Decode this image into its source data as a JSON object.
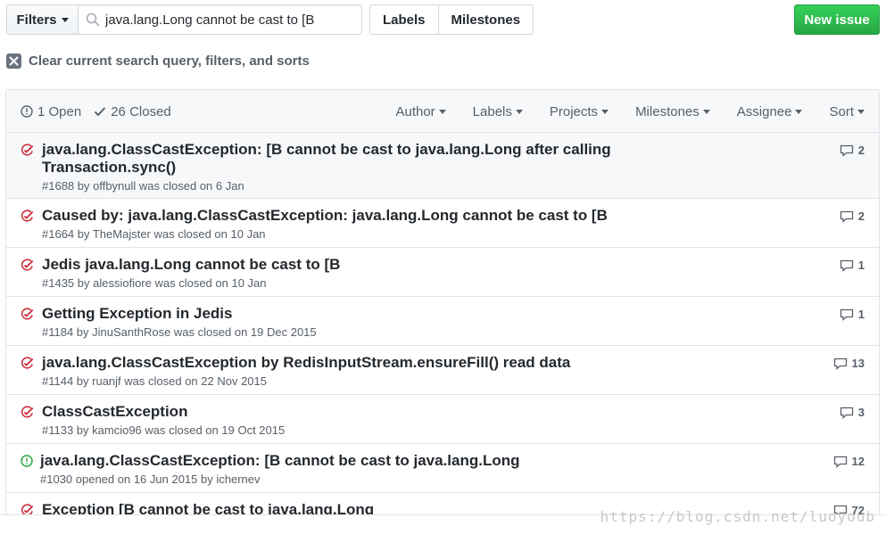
{
  "toolbar": {
    "filters_label": "Filters",
    "search_value": "java.lang.Long cannot be cast to [B",
    "labels_label": "Labels",
    "milestones_label": "Milestones",
    "new_issue_label": "New issue"
  },
  "clear_text": "Clear current search query, filters, and sorts",
  "header": {
    "open_label": "1 Open",
    "closed_label": "26 Closed",
    "menus": [
      "Author",
      "Labels",
      "Projects",
      "Milestones",
      "Assignee",
      "Sort"
    ]
  },
  "issues": [
    {
      "state": "closed",
      "title": "java.lang.ClassCastException: [B cannot be cast to java.lang.Long after calling Transaction.sync()",
      "meta": "#1688 by offbynull was closed on 6 Jan",
      "comments": "2"
    },
    {
      "state": "closed",
      "title": "Caused by: java.lang.ClassCastException: java.lang.Long cannot be cast to [B",
      "meta": "#1664 by TheMajster was closed on 10 Jan",
      "comments": "2"
    },
    {
      "state": "closed",
      "title": "Jedis java.lang.Long cannot be cast to [B",
      "meta": "#1435 by alessiofiore was closed on 10 Jan",
      "comments": "1"
    },
    {
      "state": "closed",
      "title": "Getting Exception in Jedis",
      "meta": "#1184 by JinuSanthRose was closed on 19 Dec 2015",
      "comments": "1"
    },
    {
      "state": "closed",
      "title": "java.lang.ClassCastException by RedisInputStream.ensureFill() read data",
      "meta": "#1144 by ruanjf was closed on 22 Nov 2015",
      "comments": "13"
    },
    {
      "state": "closed",
      "title": "ClassCastException",
      "meta": "#1133 by kamcio96 was closed on 19 Oct 2015",
      "comments": "3"
    },
    {
      "state": "open",
      "title": "java.lang.ClassCastException: [B cannot be cast to java.lang.Long",
      "meta": "#1030 opened on 16 Jun 2015 by ichernev",
      "comments": "12"
    },
    {
      "state": "closed",
      "title": "Exception [B cannot be cast to java.lang.Long",
      "meta": "",
      "comments": "72"
    }
  ],
  "watermark": "https://blog.csdn.net/luoyoub",
  "colors": {
    "closed": "#cb2431",
    "open": "#28a745",
    "primary": "#28a745"
  },
  "icons": {
    "closed": "issue-closed-icon",
    "open": "issue-opened-icon",
    "comment": "comment-icon",
    "search": "search-icon",
    "clear": "x-icon",
    "check": "check-icon"
  }
}
